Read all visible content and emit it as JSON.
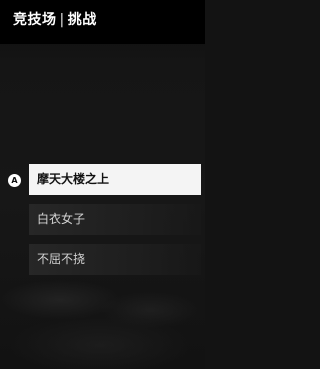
{
  "header": {
    "section": "竞技场",
    "separator": "|",
    "mode": "挑战"
  },
  "prompt": {
    "button_glyph": "A",
    "icon": "gamepad-a-button-icon"
  },
  "menu": {
    "items": [
      {
        "label": "摩天大楼之上",
        "selected": true
      },
      {
        "label": "白衣女子",
        "selected": false
      },
      {
        "label": "不屈不挠",
        "selected": false
      }
    ]
  },
  "colors": {
    "background": "#131313",
    "title_bar": "#000000",
    "selected_bg": "#f4f4f4",
    "selected_text": "#111111",
    "item_text": "#d4d4d4"
  }
}
